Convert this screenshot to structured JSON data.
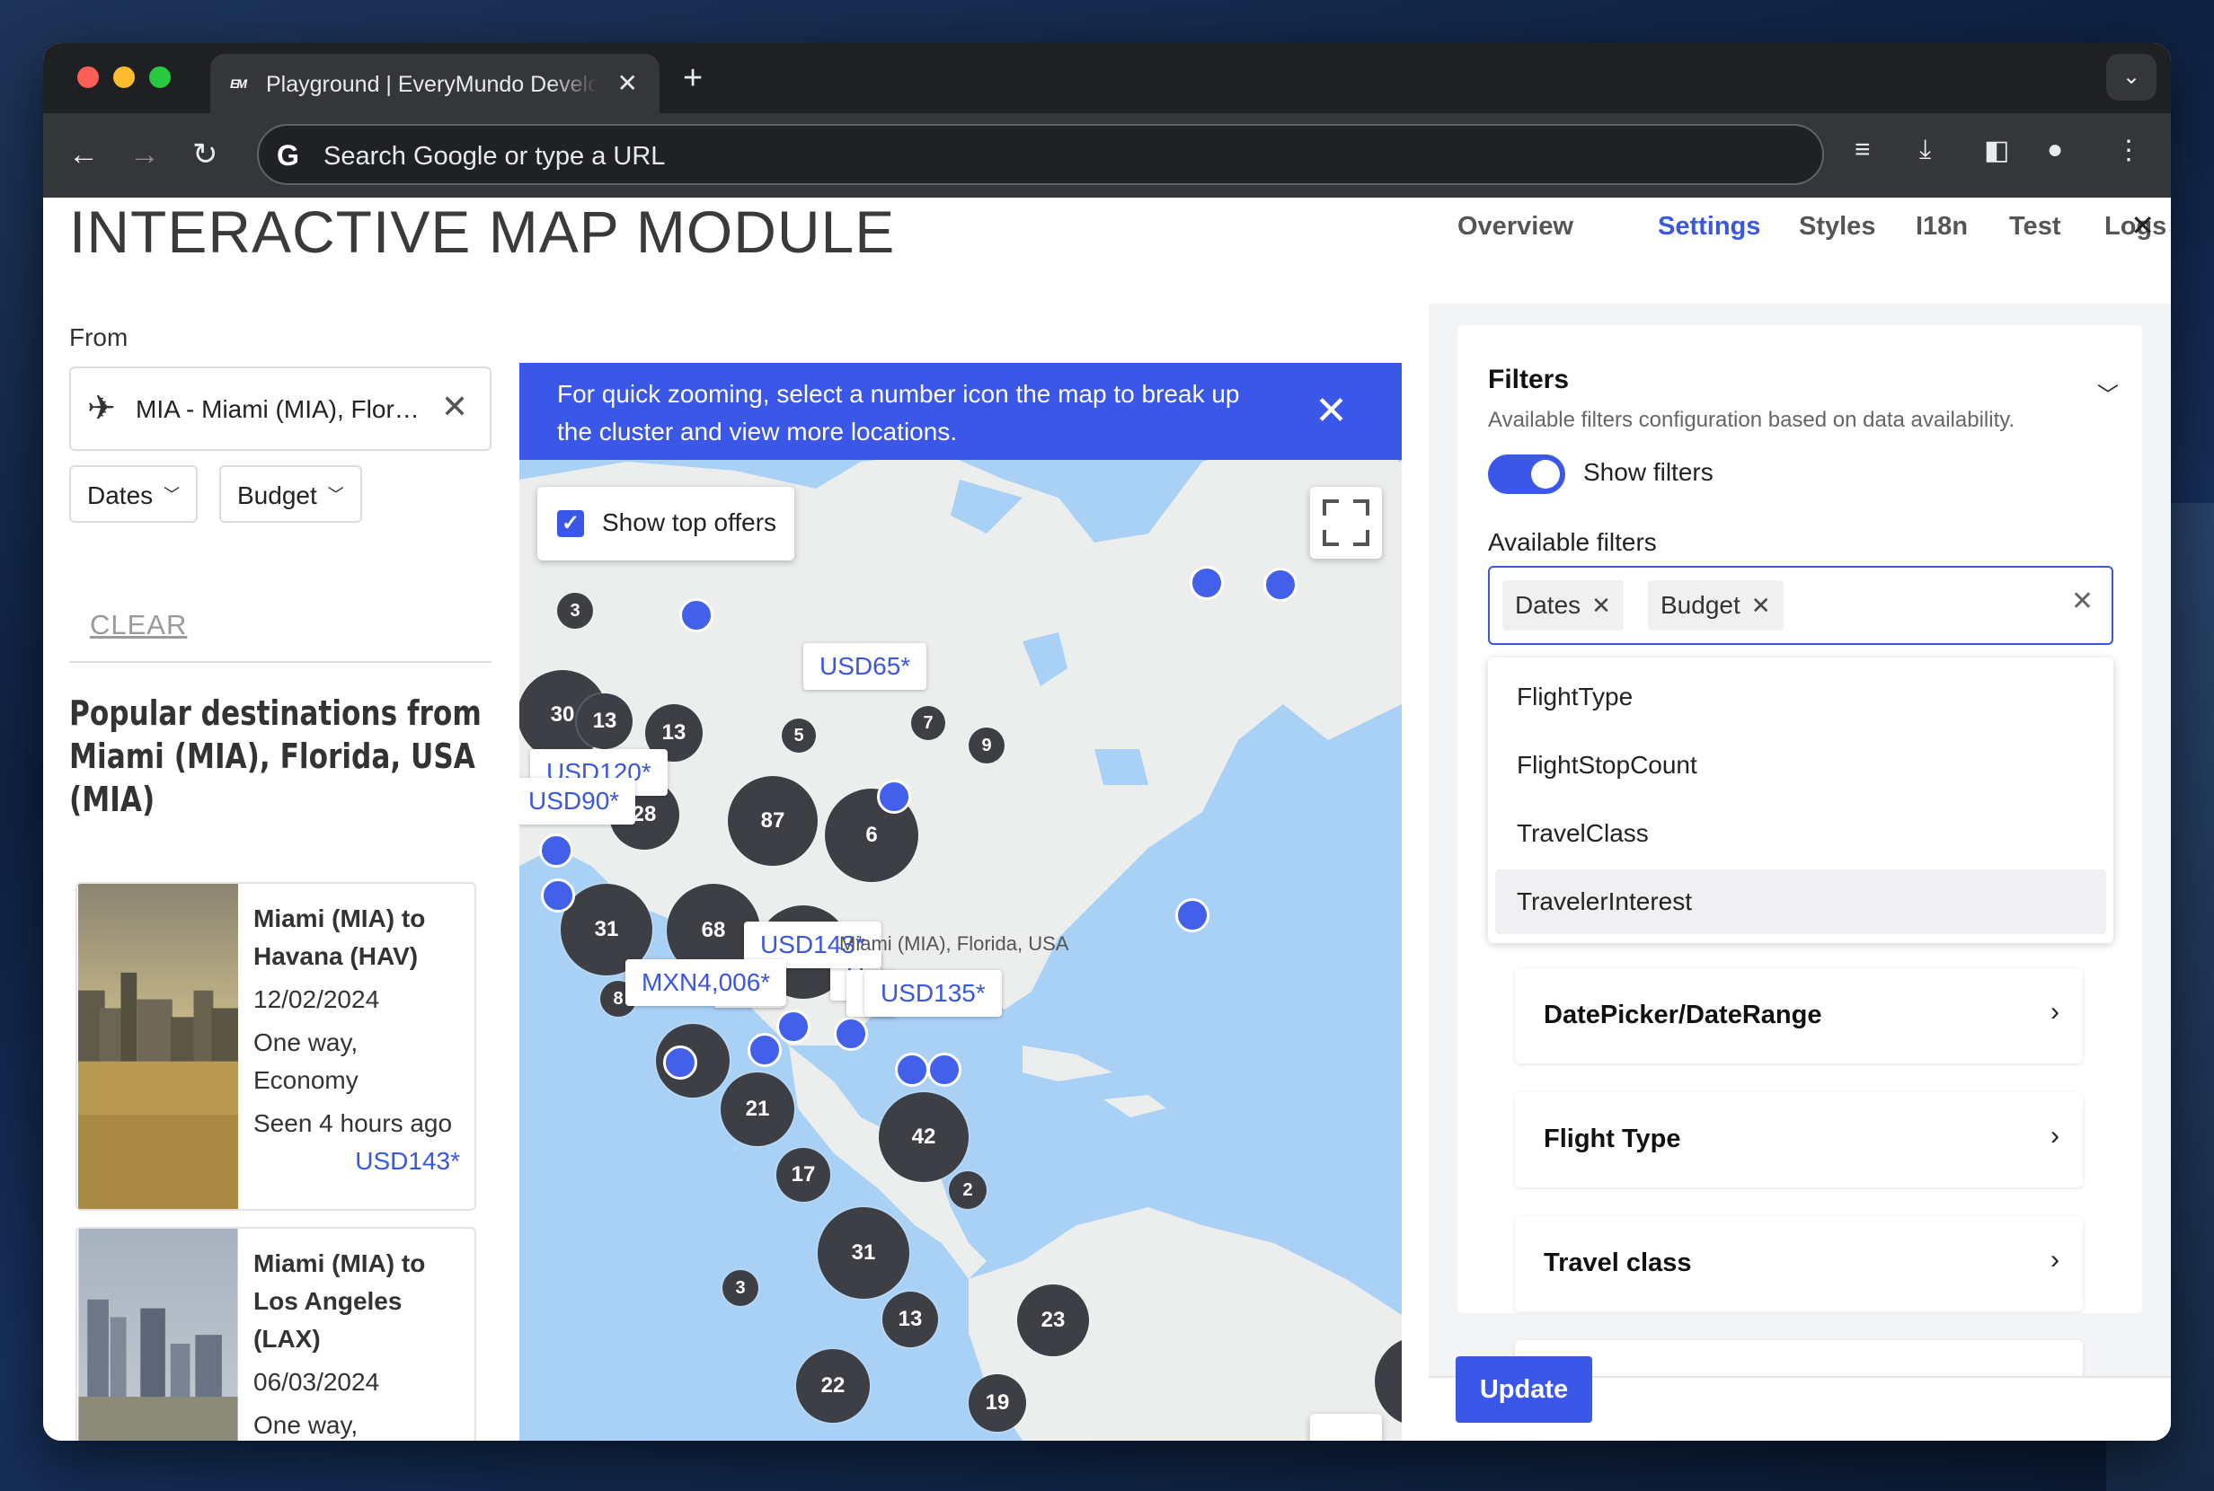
{
  "browser": {
    "tab_title": "Playground | EveryMundo Developers",
    "tab_favicon": "EM",
    "address_placeholder": "Search Google or type a URL"
  },
  "page": {
    "title": "INTERACTIVE MAP MODULE",
    "from_label": "From",
    "from_value": "MIA - Miami (MIA), Florida, USA",
    "filter_dates": "Dates",
    "filter_budget": "Budget",
    "clear": "CLEAR",
    "popular_title": "Popular destinations from Miami (MIA), Florida, USA (MIA)",
    "cards": [
      {
        "title": "Miami (MIA) to Havana (HAV)",
        "date": "12/02/2024",
        "type": "One way, Economy",
        "seen": "Seen 4 hours ago",
        "price": "USD143*"
      },
      {
        "title": "Miami (MIA) to Los Angeles (LAX)",
        "date": "06/03/2024",
        "type": "One way, Economy",
        "seen": "",
        "price": ""
      }
    ]
  },
  "map": {
    "banner": "For quick zooming, select a number icon the map to break up the cluster and view more locations.",
    "show_top_offers": "Show top offers",
    "show_top_offers_checked": true,
    "origin_label": "Miami (MIA), Florida, USA",
    "clusters": [
      "3",
      "30",
      "13",
      "13",
      "5",
      "7",
      "9",
      "28",
      "87",
      "31",
      "68",
      "77",
      "8",
      "21",
      "17",
      "42",
      "2",
      "31",
      "3",
      "13",
      "23",
      "22",
      "19",
      "6"
    ],
    "price_tags": [
      "USD65*",
      "USD120*",
      "USD90*",
      "USD143*",
      "MXN4,006*",
      "USD135*",
      "MX",
      "U"
    ]
  },
  "settings": {
    "tabs": [
      "Overview",
      "Settings",
      "Styles",
      "I18n",
      "Test",
      "Logs"
    ],
    "active_tab": "Settings",
    "filters_title": "Filters",
    "filters_desc": "Available filters configuration based on data availability.",
    "show_filters_label": "Show filters",
    "show_filters_on": true,
    "available_label": "Available filters",
    "chips": [
      "Dates",
      "Budget"
    ],
    "options": [
      "FlightType",
      "FlightStopCount",
      "TravelClass",
      "TravelerInterest"
    ],
    "highlighted_option": "TravelerInterest",
    "sections": [
      "DatePicker/DateRange",
      "Flight Type",
      "Travel class"
    ],
    "update_button": "Update"
  }
}
